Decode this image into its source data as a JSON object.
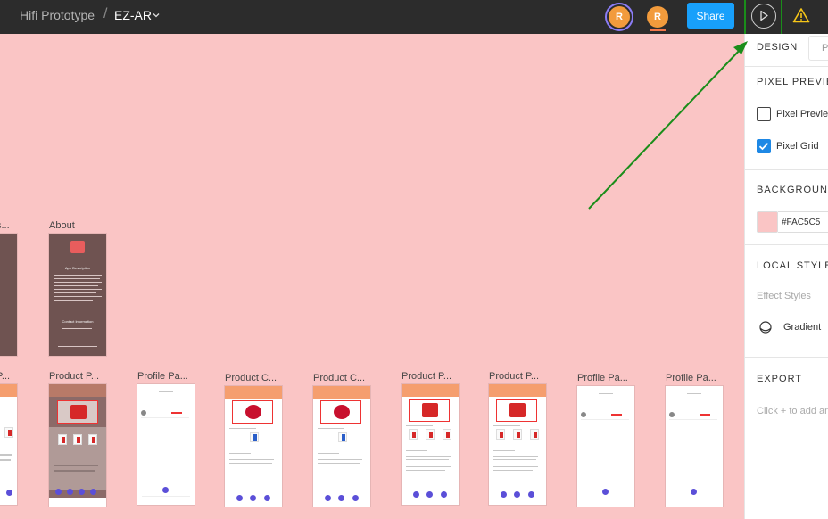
{
  "topbar": {
    "project": "Hifi Prototype",
    "separator": "/",
    "file": "EZ-AR",
    "avatar_1": "R",
    "avatar_2": "R",
    "share_label": "Share",
    "icons": [
      "chevron-down-icon",
      "play-icon",
      "warning-icon"
    ]
  },
  "canvas": {
    "background": "#FAC5C5",
    "row1": [
      {
        "label": "s..."
      },
      {
        "label": "About"
      }
    ],
    "row2": [
      {
        "label": "P..."
      },
      {
        "label": "Product P..."
      },
      {
        "label": "Profile Pa..."
      },
      {
        "label": "Product C..."
      },
      {
        "label": "Product C..."
      },
      {
        "label": "Product P..."
      },
      {
        "label": "Product P..."
      },
      {
        "label": "Profile Pa..."
      },
      {
        "label": "Profile Pa..."
      }
    ],
    "about": {
      "title": "App Description",
      "contact": "Contact Information"
    }
  },
  "panel": {
    "tab_design": "DESIGN",
    "tab_prototype": "P",
    "pixel_preview_title": "PIXEL PREVIEW",
    "pixel_preview_label": "Pixel Preview",
    "pixel_preview_checked": false,
    "pixel_grid_label": "Pixel Grid",
    "pixel_grid_checked": true,
    "background_title": "BACKGROUND",
    "background_hex": "#FAC5C5",
    "local_styles_title": "LOCAL STYLES",
    "effect_styles": "Effect Styles",
    "gradient_label": "Gradient",
    "export_title": "EXPORT",
    "export_hint": "Click + to add an export setting"
  },
  "colors": {
    "topbar": "#2c2c2c",
    "share": "#18a0fb",
    "avatar": "#F29B3C",
    "highlight": "#1a8d1a",
    "checkbox": "#1e88e5"
  }
}
